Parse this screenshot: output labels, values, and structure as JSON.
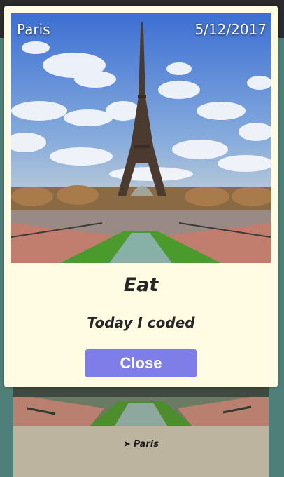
{
  "entry": {
    "location": "Paris",
    "date": "5/12/2017",
    "title": "Eat",
    "description": "Today I coded",
    "photo_alt": "Eiffel Tower"
  },
  "modal": {
    "close_label": "Close"
  },
  "background_card": {
    "location": "Paris",
    "pin_icon": "location-arrow-icon"
  }
}
